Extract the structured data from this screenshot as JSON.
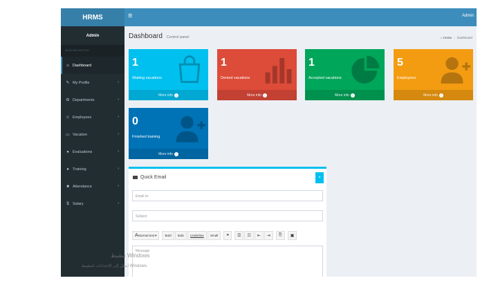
{
  "app": {
    "logo": "HRMS"
  },
  "topbar": {
    "toggle_icon": "≡",
    "user": "Admin"
  },
  "sidebar": {
    "user_name": "Admin",
    "nav_header": "MAIN NAVIGATION",
    "items": [
      {
        "label": "Dashboard",
        "icon": "⌂",
        "active": true
      },
      {
        "label": "My Profile",
        "icon": "✎",
        "chevron": "‹"
      },
      {
        "label": "Departments",
        "icon": "⚙",
        "chevron": "‹"
      },
      {
        "label": "Employees",
        "icon": "☺",
        "chevron": "‹"
      },
      {
        "label": "Vacation",
        "icon": "▭",
        "chevron": "‹"
      },
      {
        "label": "Evaluations",
        "icon": "●",
        "chevron": "‹"
      },
      {
        "label": "Training",
        "icon": "●",
        "chevron": "‹"
      },
      {
        "label": "Attendance",
        "icon": "■",
        "chevron": "‹"
      },
      {
        "label": "Salary",
        "icon": "$",
        "chevron": "‹"
      }
    ]
  },
  "header": {
    "title": "Dashboard",
    "subtitle": "Control panel"
  },
  "breadcrumb": {
    "home": "Home",
    "current": "Dashboard"
  },
  "boxes": [
    {
      "count": "1",
      "label": "Waiting vacations",
      "more": "More info",
      "color": "#00c0ef",
      "icon": "shopping-bag-icon"
    },
    {
      "count": "1",
      "label": "Denied vacations",
      "more": "More info",
      "color": "#dd4b39",
      "icon": "bar-chart-icon"
    },
    {
      "count": "1",
      "label": "Accepted vacations",
      "more": "More info",
      "color": "#00a65a",
      "icon": "pie-chart-icon"
    },
    {
      "count": "5",
      "label": "Employees",
      "more": "More info",
      "color": "#f39c12",
      "icon": "user-add-icon"
    },
    {
      "count": "0",
      "label": "Finished training",
      "more": "More info",
      "color": "#0073b7",
      "icon": "user-add-icon"
    }
  ],
  "quick_email": {
    "title": "Quick Email",
    "close": "×",
    "email_to_placeholder": "Email to:",
    "subject_placeholder": "Subject",
    "toolbar": {
      "font": "Normal text",
      "bold": "Bold",
      "italic": "Italic",
      "underline": "Underline",
      "small": "Small",
      "quote": "❝",
      "ul": "☰",
      "ol": "☷",
      "outdent": "⇤",
      "indent": "⇥",
      "link": "⎘",
      "image": "▣"
    },
    "message_placeholder": "Message"
  },
  "watermark": {
    "line1": "تنشيط Windows",
    "line2": "انتقل إلى الإعدادات لتنشيط Windows."
  }
}
